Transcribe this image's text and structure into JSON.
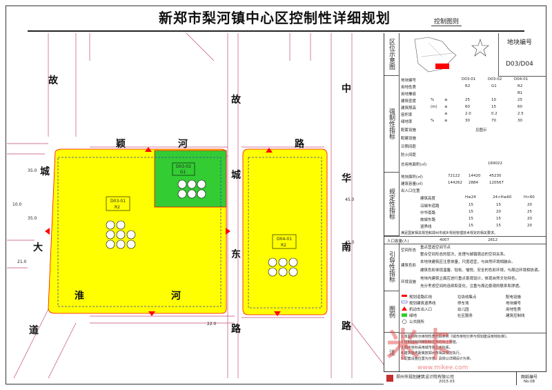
{
  "title": "新郑市梨河镇中心区控制性详细规划",
  "subtitle": "控制图则",
  "roads": {
    "road_left_upper": [
      "故"
    ],
    "road_left_lower": [
      "城",
      "大",
      "淮",
      "道"
    ],
    "road_top": [
      "颖",
      "河"
    ],
    "road_center_vertical": [
      "故",
      "城",
      "东",
      "路"
    ],
    "road_right_vertical": [
      "中",
      "华",
      "南",
      "路"
    ],
    "road_bottom": [
      "河"
    ],
    "road_top_right": [
      "路"
    ]
  },
  "parcels": {
    "d03_01": "D03-01",
    "d03_01_code": "R2",
    "d03_02": "D03-02",
    "d03_02_code": "G1",
    "d04_01": "D04-01",
    "d04_01_code": "R2"
  },
  "dims": {
    "d1": "45.0",
    "d2": "35.0",
    "d3": "35.0",
    "d4": "21.0",
    "d5": "22.0",
    "d6": "45.0",
    "d7": "10.0"
  },
  "panel": {
    "location_label": "区位示意图",
    "block_no_label": "地块编号",
    "block_no_value": "D03/D04",
    "mandatory_label": "强制性指标",
    "regulatory_label": "规定性指标",
    "guidance_label": "引导性指标",
    "legend_label": "图例",
    "header_row": [
      "地块编号",
      "D03-01",
      "D03-02",
      "D04-01"
    ],
    "rows": [
      {
        "k": "用地性质",
        "v": [
          "R2",
          "G1",
          "R2"
        ]
      },
      {
        "k": "用地兼容",
        "v": [
          "",
          "",
          "B1"
        ]
      },
      {
        "k": "建筑密度",
        "u": "%",
        "c": "≤",
        "v": [
          "25",
          "10",
          "25"
        ]
      },
      {
        "k": "建筑限高",
        "u": "(m)",
        "c": "≤",
        "v": [
          "60",
          "15",
          "60"
        ]
      },
      {
        "k": "容积率",
        "u": "",
        "c": "≤",
        "v": [
          "2.0",
          "0.2",
          "2.5"
        ]
      },
      {
        "k": "绿地率",
        "u": "%",
        "c": "≥",
        "v": [
          "30",
          "70",
          "30"
        ]
      }
    ],
    "facility_label": "配套设施",
    "facility_value": "见图示",
    "other_rows": [
      "配建设施",
      "日照间距",
      "防火间距"
    ],
    "total_area_label": "总用地面积(㎡)",
    "total_area_value": "169022",
    "area_label": "地块面积(㎡)",
    "area_values": [
      "72122",
      "14420",
      "45230"
    ],
    "gfa_label": "建筑容量(㎡)",
    "gfa_values": [
      "144262",
      "2884",
      "120567"
    ],
    "entrance_label": "出入口位置",
    "setback_header": [
      "建筑高度",
      "H≤24",
      "24<H≤60",
      "H>60"
    ],
    "setback_rows": [
      {
        "k": "沿城市道路",
        "v": [
          "15",
          "15",
          "20"
        ]
      },
      {
        "k": "中华南路",
        "v": [
          "15",
          "20",
          "25"
        ]
      },
      {
        "k": "故城东路",
        "v": [
          "15",
          "15",
          "20"
        ]
      },
      {
        "k": "退界线",
        "v": [
          "15",
          "15",
          "20"
        ]
      }
    ],
    "note_line": "满足国家相关规范和郑州市城乡规划管理技术规定的相关要求。",
    "population_label": "人口容量(人)",
    "population_values": [
      "4007",
      "",
      "2812"
    ],
    "guide_space": "空间形态",
    "guide_color": "建筑色彩",
    "guide_env": "环境设施",
    "guide_items": [
      "重点营造空间节点",
      "整合空间形态的层次，处理与城镇周边的空间关系。",
      "本地块建筑应注意体量，尺度适宜，与自然环境相融合。",
      "建筑色彩体现温馨、轻松、愉悦、安全的色彩环境，与周边环境相协调。",
      "地块内建筑立面应进行重点景观设计，体现自然文化特色。",
      "充分考虑空间的连续和变化，注重与周边景观的联系和渗透。"
    ],
    "legend_items": [
      "规划道路红线",
      "规划建筑退界线",
      "机动车出入口",
      "绿地",
      "公共厕所",
      "垃圾收集点",
      "停车场",
      "幼儿园",
      "社区服务",
      "配电设施",
      "地块编号",
      "用地性质",
      "建筑控制线"
    ],
    "notes_label": "注",
    "notes": [
      "1.本图则所示用地性质代码参照《城市用地分类与规划建设用地标准》。",
      "2.控制指标除特别标注外均为上限值。",
      "3.图中坐标采用城市独立坐标系。",
      "4.建筑退界距离按郑州市相关规定执行。",
      "5.配套设施位置为示意，具体以详细设计为准。"
    ]
  },
  "footer": {
    "company": "郑州市规划建筑设计院有限公司",
    "date": "2015.03",
    "sheet_label": "图纸编号",
    "sheet_no": "No.08"
  },
  "watermark": "米卡",
  "watermark_url": "www.mikee.com",
  "colors": {
    "residential": "#ffff00",
    "green": "#33cc33",
    "redline": "#ff0000",
    "outline": "#3a3ac0"
  }
}
